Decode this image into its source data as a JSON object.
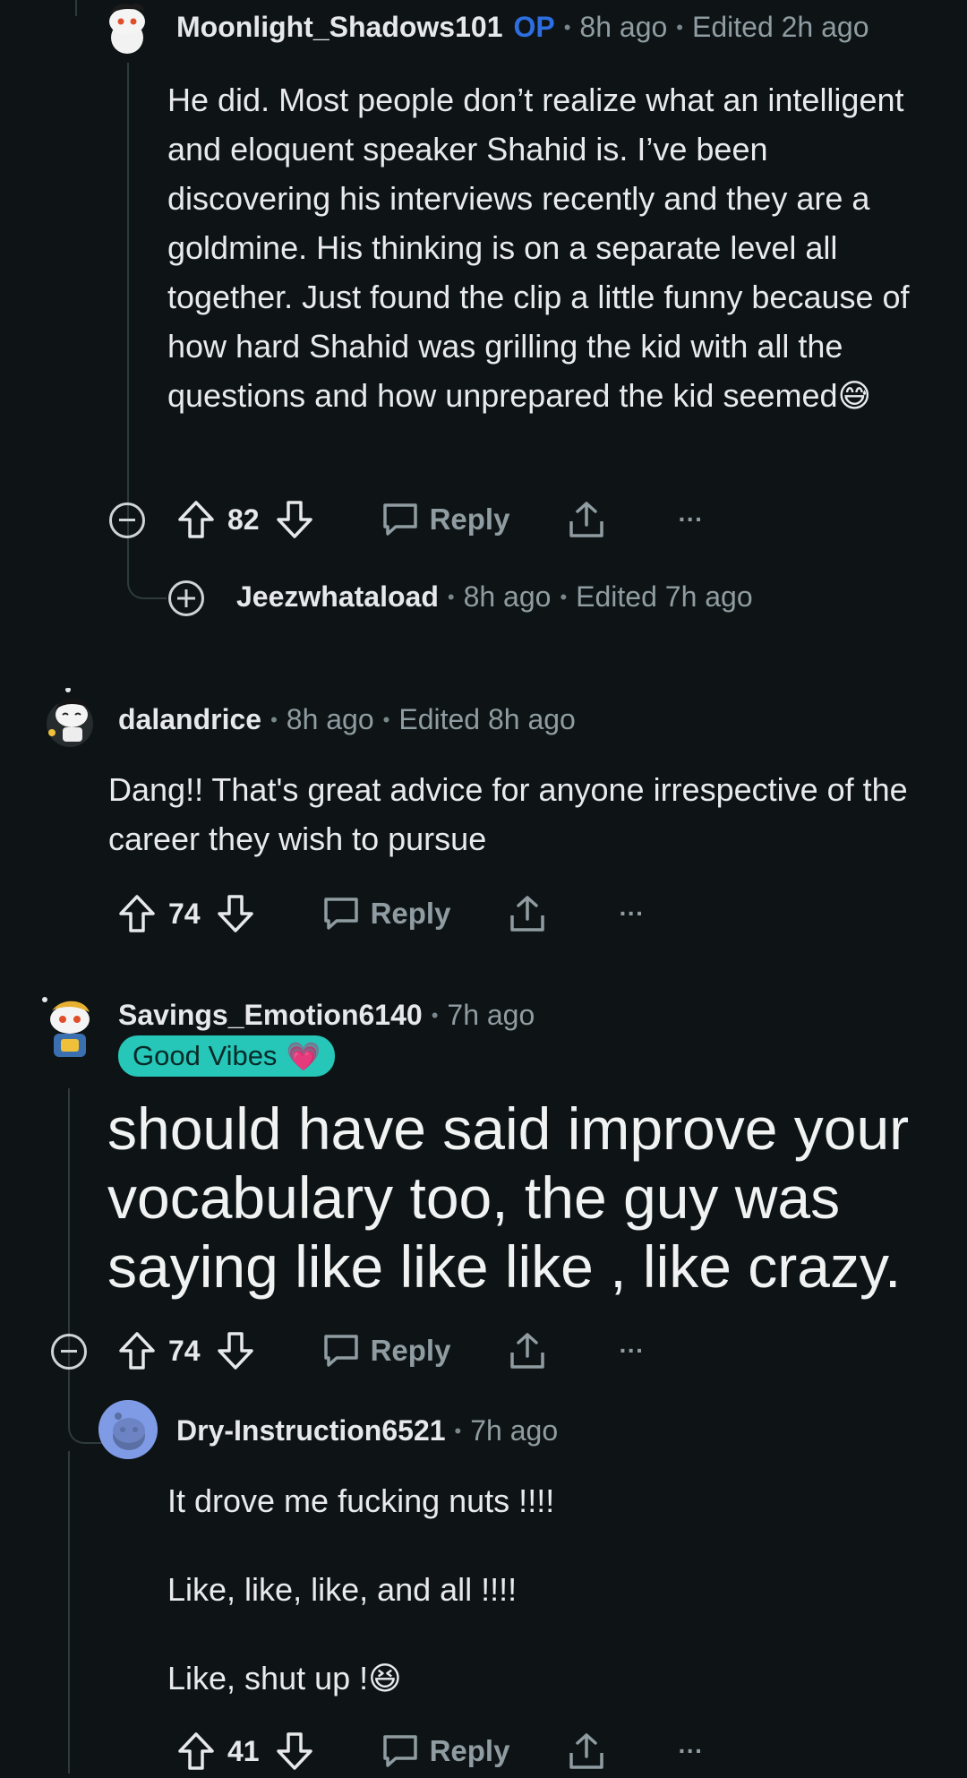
{
  "comments": [
    {
      "username": "Moonlight_Shadows101",
      "op_badge": "OP",
      "time": "8h ago",
      "edited": "Edited 2h ago",
      "body": "He did. Most people don’t realize what an intelligent and eloquent speaker Shahid is. I’ve been discovering his interviews recently and they are a goldmine. His thinking is on a separate level all together. Just found the clip a little funny because of how hard Shahid was grilling the kid with all the questions and how unprepared the kid seemed",
      "emoji": "😅",
      "votes": "82",
      "reply_label": "Reply",
      "more": "···"
    },
    {
      "username": "Jeezwhataload",
      "time": "8h ago",
      "edited": "Edited 7h ago",
      "collapsed": true
    },
    {
      "username": "dalandrice",
      "time": "8h ago",
      "edited": "Edited 8h ago",
      "body": "Dang!! That's great advice for anyone irrespective of the career they wish to pursue",
      "votes": "74",
      "reply_label": "Reply",
      "more": "···"
    },
    {
      "username": "Savings_Emotion6140",
      "time": "7h ago",
      "flair": "Good Vibes",
      "flair_emoji": "💗",
      "body": "should have said improve your vocabulary too, the guy was saying like like like , like crazy.",
      "votes": "74",
      "reply_label": "Reply",
      "more": "···"
    },
    {
      "username": "Dry-Instruction6521",
      "time": "7h ago",
      "body_lines": [
        "It drove me fucking nuts !!!!",
        "Like, like, like, and all !!!!",
        "Like, shut up !"
      ],
      "emoji": "😆",
      "votes": "41",
      "reply_label": "Reply",
      "more": "···"
    }
  ],
  "colors": {
    "background": "#0e1416",
    "op_blue": "#2d6ee0",
    "flair_teal": "#26c6b8",
    "muted": "#8f9ca1"
  },
  "icons": [
    "upvote-icon",
    "downvote-icon",
    "comment-icon",
    "share-icon",
    "collapse-icon",
    "expand-icon"
  ]
}
